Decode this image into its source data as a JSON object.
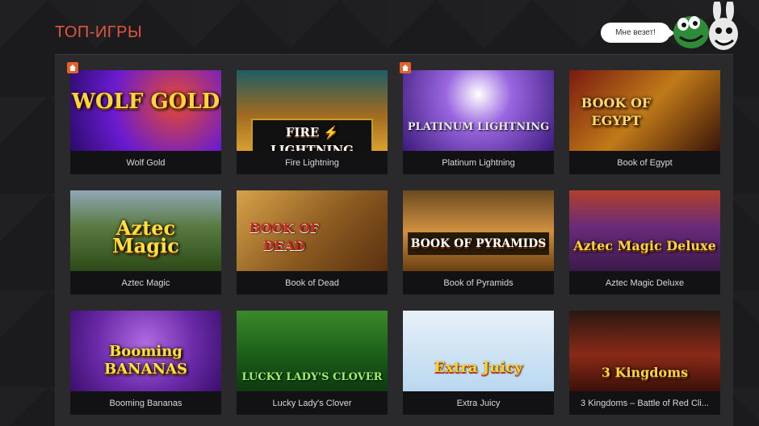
{
  "header": {
    "title": "ТОП-ИГРЫ",
    "bubble": "Мне везет!"
  },
  "games": [
    {
      "name": "Wolf Gold",
      "logo": "WOLF GOLD"
    },
    {
      "name": "Fire Lightning",
      "logo": "FIRE ⚡ LIGHTNING"
    },
    {
      "name": "Platinum Lightning",
      "logo": "PLATINUM LIGHTNING"
    },
    {
      "name": "Book of Egypt",
      "logo": "BOOK OF EGYPT"
    },
    {
      "name": "Aztec Magic",
      "logo": "Aztec Magic"
    },
    {
      "name": "Book of Dead",
      "logo": "BOOK OF DEAD"
    },
    {
      "name": "Book of Pyramids",
      "logo": "BOOK OF PYRAMIDS"
    },
    {
      "name": "Aztec Magic Deluxe",
      "logo": "Aztec Magic Deluxe"
    },
    {
      "name": "Booming Bananas",
      "logo": "Booming BANANAS"
    },
    {
      "name": "Lucky Lady's Clover",
      "logo": "LUCKY LADY'S CLOVER"
    },
    {
      "name": "Extra Juicy",
      "logo": "Extra Juicy"
    },
    {
      "name": "3 Kingdoms – Battle of Red Cli...",
      "logo": "3 Kingdoms"
    }
  ]
}
